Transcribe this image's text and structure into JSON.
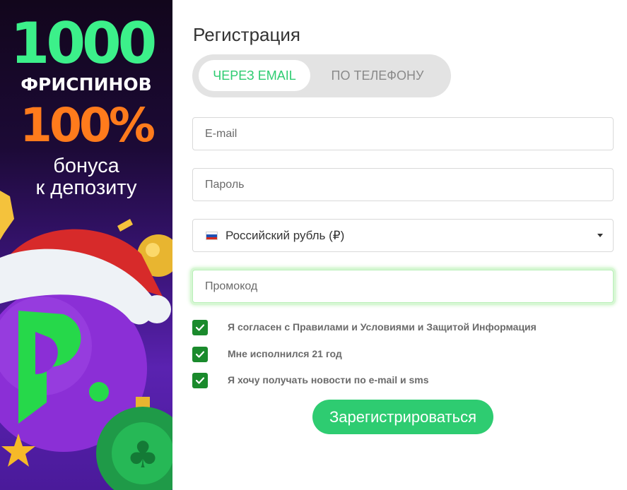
{
  "banner": {
    "freespins_count": "1000",
    "freespins_label": "ФРИСПИНОВ",
    "bonus_percent": "100%",
    "bonus_line1": "бонуса",
    "bonus_line2": "к депозиту"
  },
  "form": {
    "title": "Регистрация",
    "tabs": [
      {
        "label": "ЧЕРЕЗ EMAIL",
        "active": true
      },
      {
        "label": "ПО ТЕЛЕФОНУ",
        "active": false
      }
    ],
    "email_placeholder": "E-mail",
    "password_placeholder": "Пароль",
    "currency": {
      "value": "Российский рубль (₽)",
      "flag_icon": "russia-flag-icon"
    },
    "promo_placeholder": "Промокод",
    "checkboxes": [
      {
        "label": "Я согласен с Правилами и Условиями и Защитой Информация",
        "checked": true
      },
      {
        "label": "Мне исполнился 21 год",
        "checked": true
      },
      {
        "label": "Я хочу получать новости по e-mail и sms",
        "checked": true
      }
    ],
    "submit_label": "Зарегистрироваться"
  },
  "colors": {
    "accent": "#2ecc71",
    "checkbox": "#1a8a2c",
    "tab_bg": "#e3e3e3",
    "banner_green": "#3cf08a",
    "banner_orange": "#ff7b1c"
  }
}
